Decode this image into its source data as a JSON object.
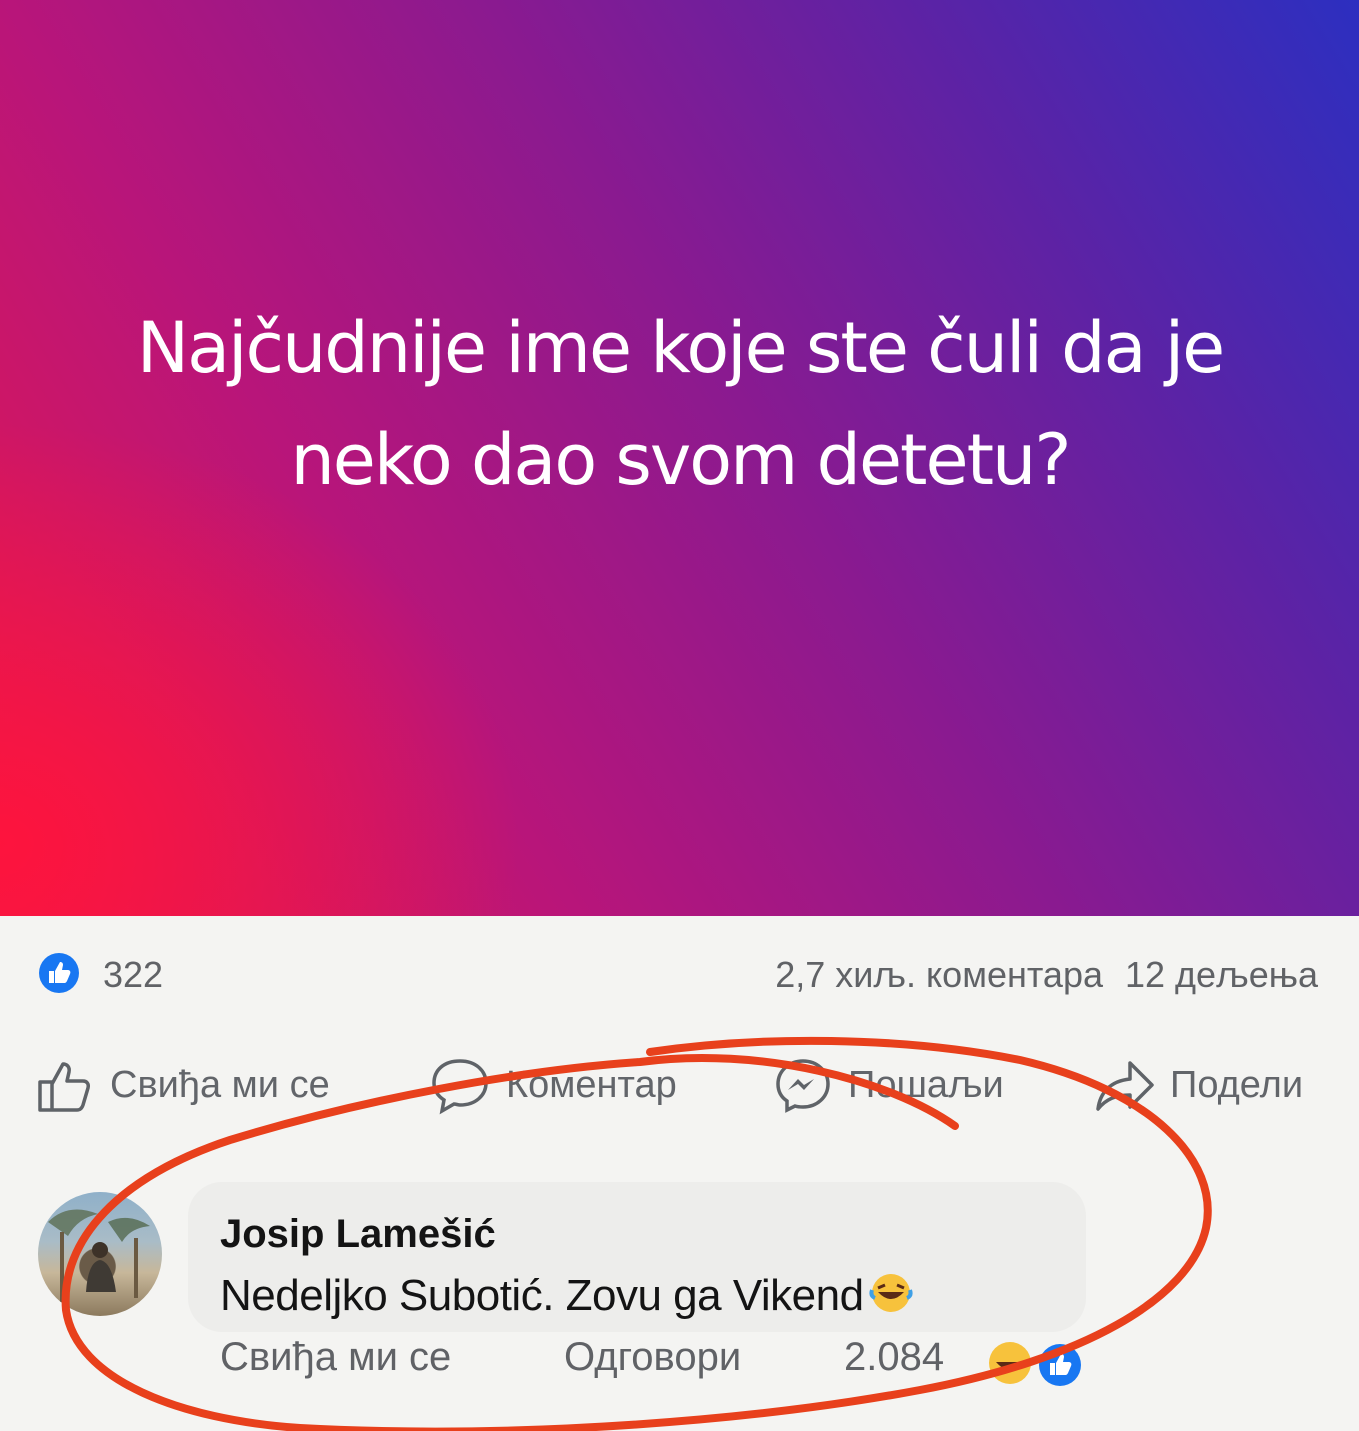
{
  "post": {
    "text": "Najčudnije ime koje ste čuli da je neko dao svom detetu?",
    "colors": {
      "gradient_left": "#e6184f",
      "gradient_right": "#2c2fc0",
      "text": "#ffffff"
    }
  },
  "stats": {
    "likes": "322",
    "comments": "2,7 хиљ. коментара",
    "shares": "12 дељења",
    "reaction_icon": "like-icon"
  },
  "actions": {
    "like": "Свиђа ми се",
    "comment": "Коментар",
    "send": "Пошаљи",
    "share": "Подели"
  },
  "comment": {
    "author": "Josip Lamešić",
    "text": "Nedeljko Subotić. Zovu ga Vikend",
    "emoji": "rolling-on-floor-laughing-emoji",
    "like_label": "Свиђа ми се",
    "reply_label": "Одговори",
    "reaction_count": "2.084"
  },
  "annotation": {
    "color": "#e8401c",
    "shape": "freehand-circle"
  }
}
